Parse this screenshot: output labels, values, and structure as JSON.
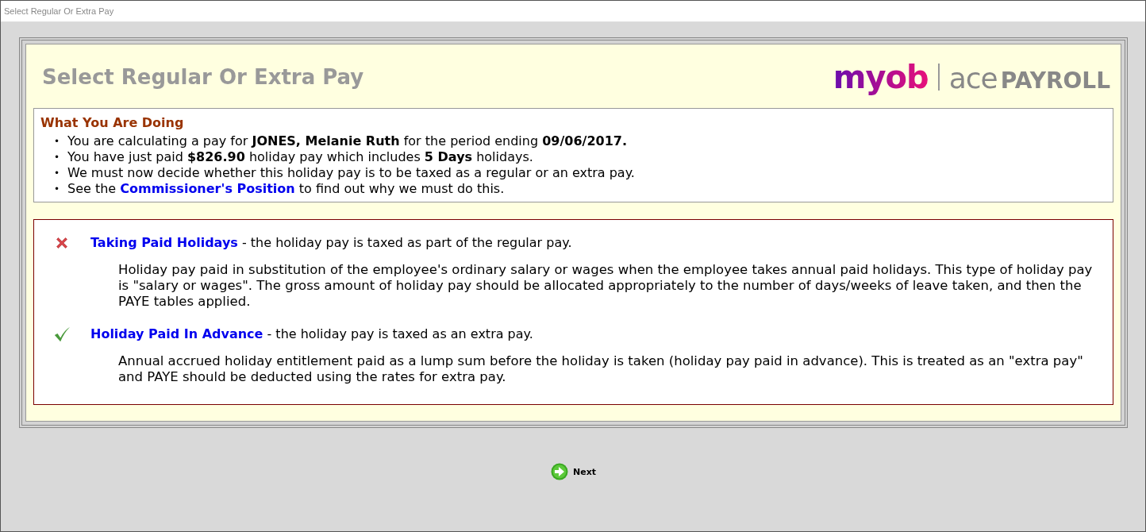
{
  "window": {
    "title": "Select Regular Or Extra Pay"
  },
  "page": {
    "heading": "Select Regular Or Extra Pay",
    "logo": {
      "brand": "myob",
      "product": "ace",
      "product_bold": "PAYROLL"
    }
  },
  "info": {
    "title": "What You Are Doing",
    "bullets": [
      {
        "marker": "•",
        "parts": [
          {
            "kind": "text",
            "text": "You are calculating a pay for **JONES, Melanie Ruth** for the period ending **09/06/2017.**"
          }
        ]
      },
      {
        "marker": "•",
        "parts": [
          {
            "kind": "text",
            "text": "You have just paid **$826.90** holiday pay which includes **5 Days** holidays."
          }
        ]
      },
      {
        "marker": "•",
        "parts": [
          {
            "kind": "text",
            "text": "We must now decide whether this holiday pay is to be taxed as a regular or an extra pay."
          }
        ]
      },
      {
        "marker": "•",
        "parts": [
          {
            "kind": "text",
            "text": "See the "
          },
          {
            "kind": "link",
            "text": "Commissioner's Position"
          },
          {
            "kind": "text",
            "text": " to find out why we must do this."
          }
        ]
      }
    ]
  },
  "options": [
    {
      "applies": false,
      "link": "Taking Paid Holidays",
      "summary": " - the holiday pay is taxed as part of the regular pay.",
      "description": "Holiday pay paid in substitution of the employee's ordinary salary or wages when the employee takes annual paid holidays. This type of holiday pay is \"salary or wages\". The gross amount of holiday pay should be allocated appropriately to the number of days/weeks of leave taken, and then the PAYE tables applied."
    },
    {
      "applies": true,
      "link": "Holiday Paid In Advance",
      "summary": " - the holiday pay is taxed as an extra pay.",
      "description": "Annual accrued holiday entitlement paid as a lump sum before the holiday is taken (holiday pay paid in advance). This is treated as an \"extra pay\" and PAYE should be deducted using the rates for extra pay."
    }
  ],
  "buttons": [
    {
      "label": "Next"
    }
  ]
}
